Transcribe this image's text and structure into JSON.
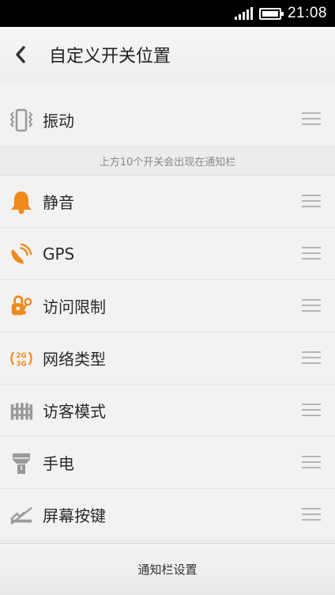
{
  "status_bar": {
    "time": "21:08"
  },
  "header": {
    "title": "自定义开关位置"
  },
  "top_items": [
    {
      "label": "振动",
      "icon": "vibrate-icon"
    }
  ],
  "divider_note": "上方10个开关会出现在通知栏",
  "items": [
    {
      "label": "静音",
      "icon": "bell-icon"
    },
    {
      "label": "GPS",
      "icon": "gps-satellite-icon"
    },
    {
      "label": "访问限制",
      "icon": "restriction-key-icon"
    },
    {
      "label": "网络类型",
      "icon": "network-type-icon"
    },
    {
      "label": "访客模式",
      "icon": "guest-fence-icon"
    },
    {
      "label": "手电",
      "icon": "flashlight-icon"
    },
    {
      "label": "屏幕按键",
      "icon": "screen-buttons-icon"
    }
  ],
  "bottom_bar": {
    "label": "通知栏设置"
  },
  "colors": {
    "accent": "#f08a1c",
    "inactive_icon": "#9a9a9a"
  }
}
